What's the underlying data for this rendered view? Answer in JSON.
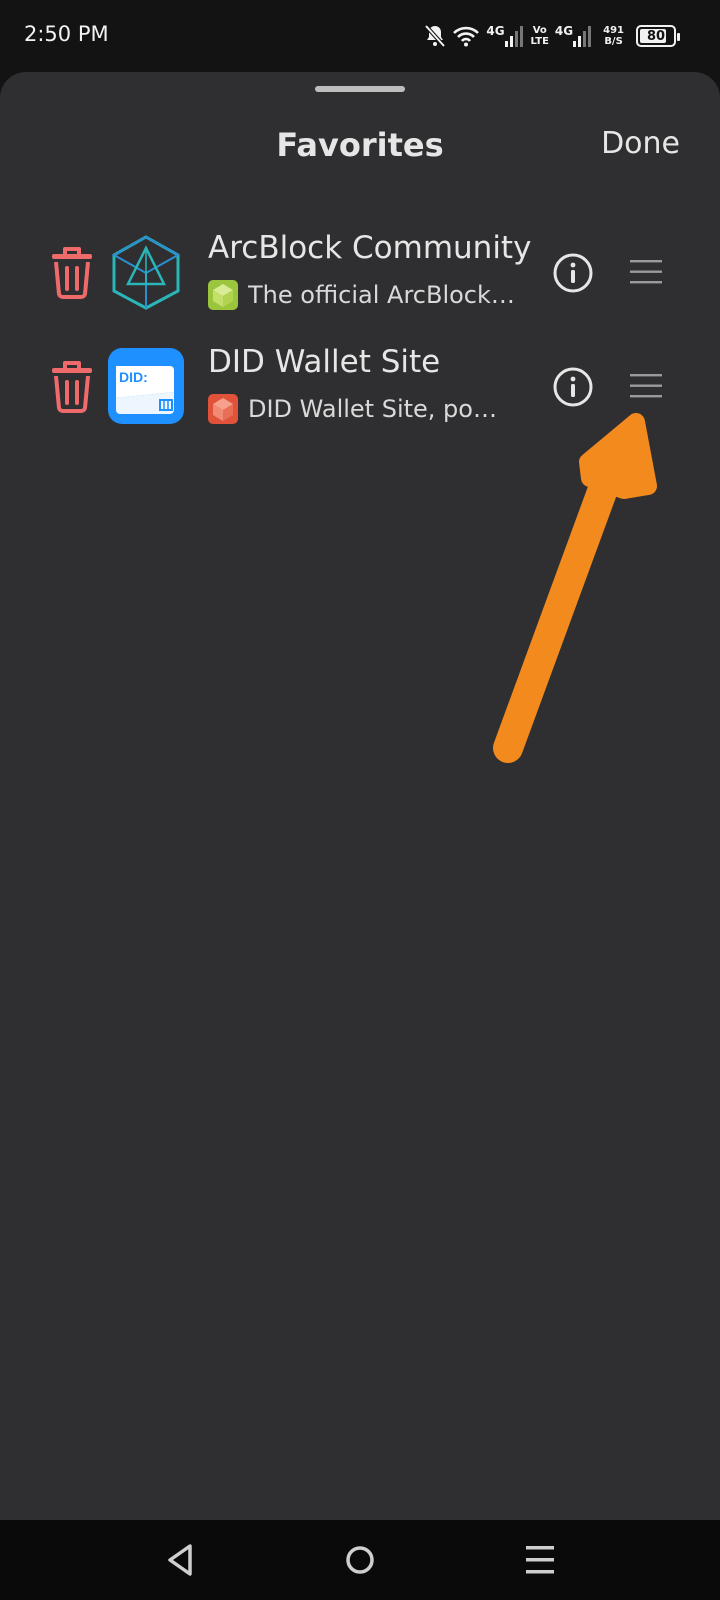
{
  "status_bar": {
    "time": "2:50 PM",
    "network_1": "4G",
    "volte_top": "Vo",
    "volte_bottom": "LTE",
    "network_2": "4G",
    "speed_value": "491",
    "speed_unit": "B/S",
    "battery_level": 80,
    "battery_text": "80"
  },
  "sheet": {
    "title": "Favorites",
    "done_label": "Done"
  },
  "favorites": [
    {
      "title": "ArcBlock Community",
      "subtitle": "The official ArcBlock…",
      "icon": "arcblock-cube-icon",
      "sub_icon": "arcblock-favicon-icon"
    },
    {
      "title": "DID Wallet Site",
      "subtitle": "DID Wallet Site, po…",
      "icon": "did-wallet-icon",
      "icon_text": "DID:",
      "sub_icon": "did-wallet-favicon-icon"
    }
  ],
  "colors": {
    "trash": "#ef6b6b",
    "annotation": "#f28a1d",
    "did_blue": "#1e90ff",
    "arc_teal": "#2ab6b8"
  }
}
